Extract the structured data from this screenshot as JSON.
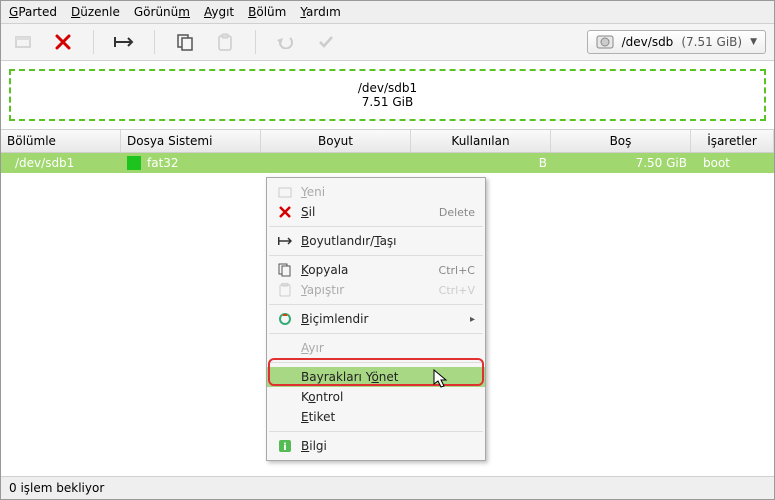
{
  "menubar": {
    "gparted": "GParted",
    "duzenle": "Düzenle",
    "gorunum": "Görünüm",
    "aygit": "Aygıt",
    "bolum": "Bölüm",
    "yardim": "Yardım"
  },
  "device_selector": {
    "path": "/dev/sdb",
    "size": "(7.51 GiB)"
  },
  "diskmap": {
    "name": "/dev/sdb1",
    "size": "7.51 GiB"
  },
  "columns": {
    "partition": "Bölümle",
    "filesystem": "Dosya Sistemi",
    "size": "Boyut",
    "used": "Kullanılan",
    "free": "Boş",
    "flags": "İşaretler"
  },
  "row": {
    "partition": "/dev/sdb1",
    "filesystem": "fat32",
    "used_suffix": "B",
    "free": "7.50 GiB",
    "flags": "boot"
  },
  "context_menu": {
    "new": "Yeni",
    "delete": "Sil",
    "delete_accel": "Delete",
    "resize": "Boyutlandır/Taşı",
    "copy": "Kopyala",
    "copy_accel": "Ctrl+C",
    "paste": "Yapıştır",
    "paste_accel": "Ctrl+V",
    "format": "Biçimlendir",
    "unmount": "Ayır",
    "manage_flags": "Bayrakları Yönet",
    "check": "Kontrol",
    "label": "Etiket",
    "info": "Bilgi"
  },
  "status": "0 işlem bekliyor"
}
